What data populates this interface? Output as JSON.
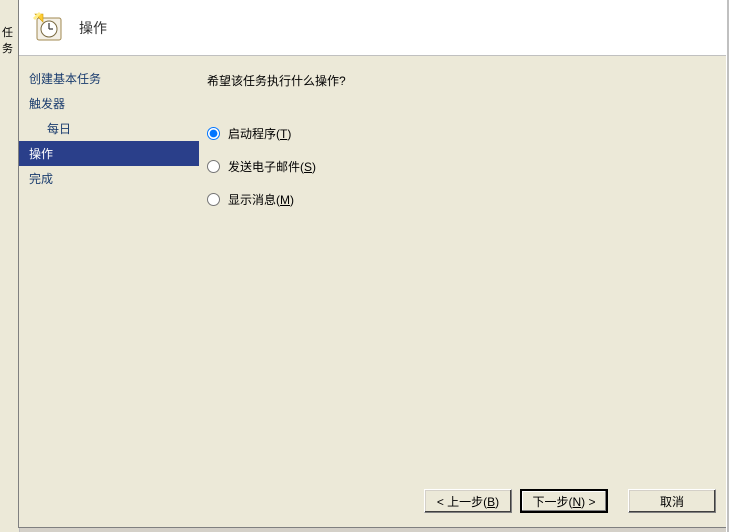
{
  "bg_window": {
    "truncated_label": "任务"
  },
  "header": {
    "title": "操作"
  },
  "sidebar": {
    "items": [
      {
        "label": "创建基本任务",
        "indent": false
      },
      {
        "label": "触发器",
        "indent": false
      },
      {
        "label": "每日",
        "indent": true
      },
      {
        "label": "操作",
        "indent": false,
        "selected": true
      },
      {
        "label": "完成",
        "indent": false
      }
    ]
  },
  "content": {
    "prompt": "希望该任务执行什么操作?",
    "options": [
      {
        "label": "启动程序",
        "accel": "T",
        "checked": true
      },
      {
        "label": "发送电子邮件",
        "accel": "S",
        "checked": false
      },
      {
        "label": "显示消息",
        "accel": "M",
        "checked": false
      }
    ]
  },
  "buttons": {
    "back_prefix": "< 上一步(",
    "back_accel": "B",
    "back_suffix": ")",
    "next_prefix": "下一步(",
    "next_accel": "N",
    "next_suffix": ") >",
    "cancel": "取消"
  }
}
